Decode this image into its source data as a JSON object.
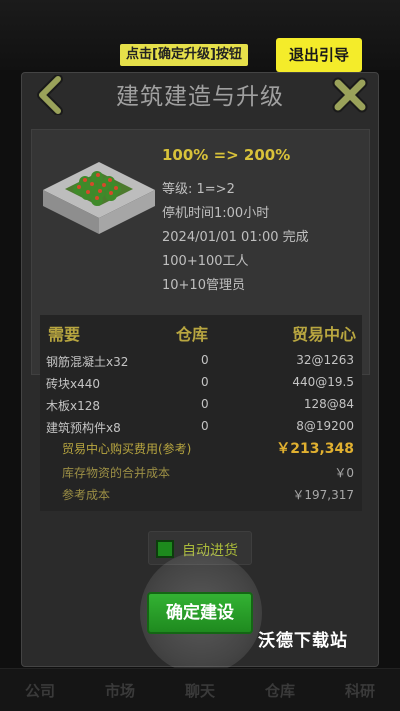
{
  "guide": {
    "hint": "点击[确定升级]按钮",
    "exit_label": "退出引导"
  },
  "dialog": {
    "title": "建筑建造与升级",
    "building": {
      "name": "农场",
      "efficiency": "100% => 200%",
      "details": [
        "等级: 1=>2",
        "停机时间1:00小时",
        "2024/01/01 01:00 完成",
        "100+100工人",
        "10+10管理员"
      ]
    },
    "cost_table": {
      "headers": [
        "需要",
        "仓库",
        "贸易中心"
      ],
      "rows": [
        {
          "item": "钢筋混凝土x32",
          "warehouse": "0",
          "trade": "32@1263"
        },
        {
          "item": "砖块x440",
          "warehouse": "0",
          "trade": "440@19.5"
        },
        {
          "item": "木板x128",
          "warehouse": "0",
          "trade": "128@84"
        },
        {
          "item": "建筑预构件x8",
          "warehouse": "0",
          "trade": "8@19200"
        }
      ],
      "summary": [
        {
          "label": "贸易中心购买费用(参考)",
          "value": "￥213,348",
          "highlight": true
        },
        {
          "label": "库存物资的合并成本",
          "value": "￥0",
          "highlight": false
        },
        {
          "label": "参考成本",
          "value": "￥197,317",
          "highlight": false
        }
      ]
    },
    "auto_purchase_label": "自动进货",
    "auto_purchase_checked": true,
    "confirm_label": "确定建设"
  },
  "background_tabs": [
    "公司",
    "市场",
    "聊天",
    "仓库",
    "科研"
  ],
  "watermark": "沃德下载站",
  "colors": {
    "accent_yellow": "#f4ec2a",
    "confirm_green": "#2a9f2a",
    "price_highlight": "#e0b030"
  }
}
